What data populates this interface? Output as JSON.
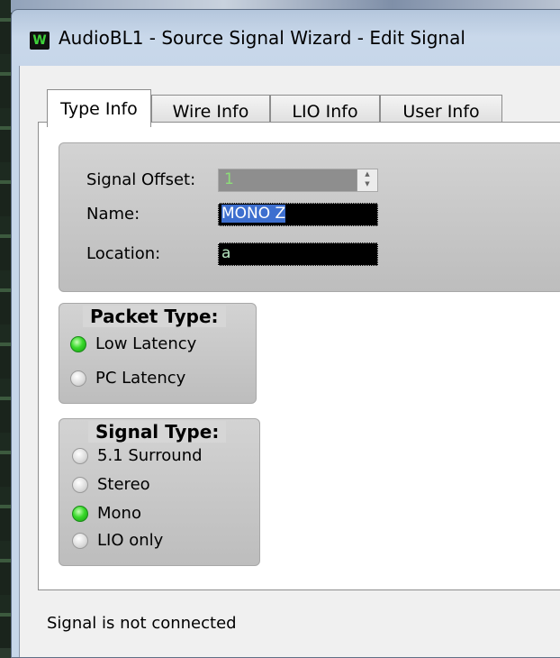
{
  "window": {
    "title": "AudioBL1 - Source Signal Wizard - Edit Signal",
    "app_icon_letter": "W"
  },
  "tabs": [
    {
      "label": "Type Info",
      "active": true
    },
    {
      "label": "Wire Info",
      "active": false
    },
    {
      "label": "LIO Info",
      "active": false
    },
    {
      "label": "User Info",
      "active": false
    }
  ],
  "signal_fields": {
    "offset_label": "Signal Offset:",
    "offset_value": "1",
    "name_label": "Name:",
    "name_value": "MONO Z",
    "location_label": "Location:",
    "location_value": "a"
  },
  "packet_type": {
    "title": "Packet Type:",
    "options": [
      {
        "label": "Low Latency",
        "selected": true
      },
      {
        "label": "PC Latency",
        "selected": false
      }
    ]
  },
  "signal_type": {
    "title": "Signal Type:",
    "options": [
      {
        "label": "5.1 Surround",
        "selected": false
      },
      {
        "label": "Stereo",
        "selected": false
      },
      {
        "label": "Mono",
        "selected": true
      },
      {
        "label": "LIO only",
        "selected": false
      }
    ]
  },
  "status_text": "Signal is not connected",
  "colors": {
    "led_on": "#39d92b",
    "field_bg": "#000000",
    "selection": "#3d6fcf"
  }
}
